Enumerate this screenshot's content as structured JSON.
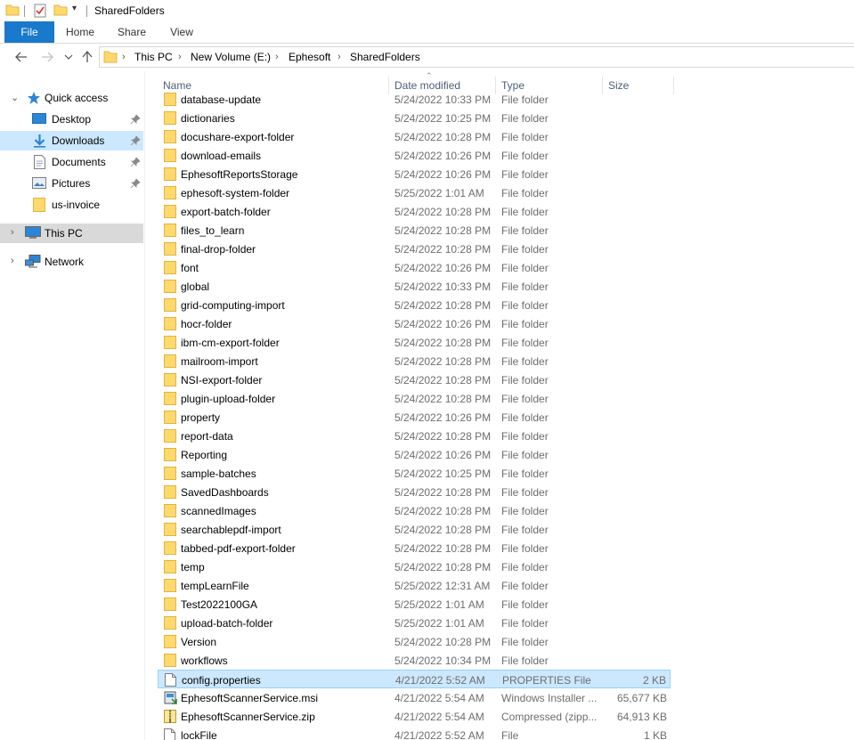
{
  "window": {
    "title": "SharedFolders"
  },
  "ribbon": {
    "tabs": [
      "File",
      "Home",
      "Share",
      "View"
    ]
  },
  "address": {
    "crumbs": [
      "This PC",
      "New Volume (E:)",
      "Ephesoft",
      "SharedFolders"
    ]
  },
  "nav": {
    "quick_access": "Quick access",
    "items": [
      "Desktop",
      "Downloads",
      "Documents",
      "Pictures",
      "us-invoice"
    ],
    "this_pc": "This PC",
    "network": "Network"
  },
  "columns": {
    "name": "Name",
    "date": "Date modified",
    "type": "Type",
    "size": "Size"
  },
  "files": [
    {
      "name": "database-update",
      "date": "5/24/2022 10:33 PM",
      "type": "File folder",
      "size": ""
    },
    {
      "name": "dictionaries",
      "date": "5/24/2022 10:25 PM",
      "type": "File folder",
      "size": ""
    },
    {
      "name": "docushare-export-folder",
      "date": "5/24/2022 10:28 PM",
      "type": "File folder",
      "size": ""
    },
    {
      "name": "download-emails",
      "date": "5/24/2022 10:26 PM",
      "type": "File folder",
      "size": ""
    },
    {
      "name": "EphesoftReportsStorage",
      "date": "5/24/2022 10:26 PM",
      "type": "File folder",
      "size": ""
    },
    {
      "name": "ephesoft-system-folder",
      "date": "5/25/2022 1:01 AM",
      "type": "File folder",
      "size": ""
    },
    {
      "name": "export-batch-folder",
      "date": "5/24/2022 10:28 PM",
      "type": "File folder",
      "size": ""
    },
    {
      "name": "files_to_learn",
      "date": "5/24/2022 10:28 PM",
      "type": "File folder",
      "size": ""
    },
    {
      "name": "final-drop-folder",
      "date": "5/24/2022 10:28 PM",
      "type": "File folder",
      "size": ""
    },
    {
      "name": "font",
      "date": "5/24/2022 10:26 PM",
      "type": "File folder",
      "size": ""
    },
    {
      "name": "global",
      "date": "5/24/2022 10:33 PM",
      "type": "File folder",
      "size": ""
    },
    {
      "name": "grid-computing-import",
      "date": "5/24/2022 10:28 PM",
      "type": "File folder",
      "size": ""
    },
    {
      "name": "hocr-folder",
      "date": "5/24/2022 10:26 PM",
      "type": "File folder",
      "size": ""
    },
    {
      "name": "ibm-cm-export-folder",
      "date": "5/24/2022 10:28 PM",
      "type": "File folder",
      "size": ""
    },
    {
      "name": "mailroom-import",
      "date": "5/24/2022 10:28 PM",
      "type": "File folder",
      "size": ""
    },
    {
      "name": "NSI-export-folder",
      "date": "5/24/2022 10:28 PM",
      "type": "File folder",
      "size": ""
    },
    {
      "name": "plugin-upload-folder",
      "date": "5/24/2022 10:28 PM",
      "type": "File folder",
      "size": ""
    },
    {
      "name": "property",
      "date": "5/24/2022 10:26 PM",
      "type": "File folder",
      "size": ""
    },
    {
      "name": "report-data",
      "date": "5/24/2022 10:28 PM",
      "type": "File folder",
      "size": ""
    },
    {
      "name": "Reporting",
      "date": "5/24/2022 10:26 PM",
      "type": "File folder",
      "size": ""
    },
    {
      "name": "sample-batches",
      "date": "5/24/2022 10:25 PM",
      "type": "File folder",
      "size": ""
    },
    {
      "name": "SavedDashboards",
      "date": "5/24/2022 10:28 PM",
      "type": "File folder",
      "size": ""
    },
    {
      "name": "scannedImages",
      "date": "5/24/2022 10:28 PM",
      "type": "File folder",
      "size": ""
    },
    {
      "name": "searchablepdf-import",
      "date": "5/24/2022 10:28 PM",
      "type": "File folder",
      "size": ""
    },
    {
      "name": "tabbed-pdf-export-folder",
      "date": "5/24/2022 10:28 PM",
      "type": "File folder",
      "size": ""
    },
    {
      "name": "temp",
      "date": "5/24/2022 10:28 PM",
      "type": "File folder",
      "size": ""
    },
    {
      "name": "tempLearnFile",
      "date": "5/25/2022 12:31 AM",
      "type": "File folder",
      "size": ""
    },
    {
      "name": "Test2022100GA",
      "date": "5/25/2022 1:01 AM",
      "type": "File folder",
      "size": ""
    },
    {
      "name": "upload-batch-folder",
      "date": "5/25/2022 1:01 AM",
      "type": "File folder",
      "size": ""
    },
    {
      "name": "Version",
      "date": "5/24/2022 10:28 PM",
      "type": "File folder",
      "size": ""
    },
    {
      "name": "workflows",
      "date": "5/24/2022 10:34 PM",
      "type": "File folder",
      "size": ""
    },
    {
      "name": "config.properties",
      "date": "4/21/2022 5:52 AM",
      "type": "PROPERTIES File",
      "size": "2 KB",
      "icon": "file",
      "selected": true
    },
    {
      "name": "EphesoftScannerService.msi",
      "date": "4/21/2022 5:54 AM",
      "type": "Windows Installer ...",
      "size": "65,677 KB",
      "icon": "msi"
    },
    {
      "name": "EphesoftScannerService.zip",
      "date": "4/21/2022 5:54 AM",
      "type": "Compressed (zipp...",
      "size": "64,913 KB",
      "icon": "zip"
    },
    {
      "name": "lockFile",
      "date": "4/21/2022 5:52 AM",
      "type": "File",
      "size": "1 KB",
      "icon": "file"
    }
  ],
  "colors": {
    "file_tab": "#1979ca",
    "selection": "#cce8ff",
    "folder": "#ffd96e"
  }
}
